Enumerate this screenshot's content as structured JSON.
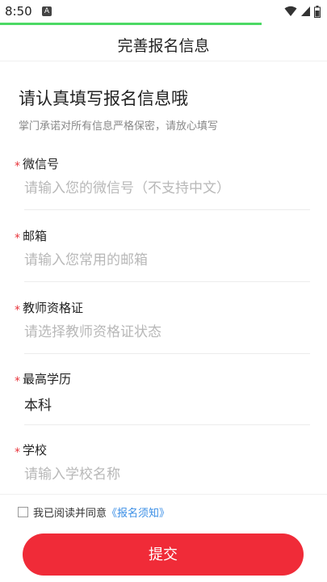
{
  "status_bar": {
    "time": "8:50",
    "notif_icon": "A"
  },
  "header": {
    "title": "完善报名信息"
  },
  "intro": {
    "title": "请认真填写报名信息哦",
    "subtitle": "掌门承诺对所有信息严格保密，请放心填写"
  },
  "form": {
    "required_mark": "*",
    "fields": [
      {
        "label": "微信号",
        "placeholder": "请输入您的微信号（不支持中文）",
        "value": ""
      },
      {
        "label": "邮箱",
        "placeholder": "请输入您常用的邮箱",
        "value": ""
      },
      {
        "label": "教师资格证",
        "placeholder": "请选择教师资格证状态",
        "value": ""
      },
      {
        "label": "最高学历",
        "placeholder": "",
        "value": "本科"
      },
      {
        "label": "学校",
        "placeholder": "请输入学校名称",
        "value": ""
      }
    ]
  },
  "agreement": {
    "checked": false,
    "text": "我已阅读并同意",
    "link": "《报名须知》"
  },
  "submit": {
    "label": "提交"
  },
  "colors": {
    "accent": "#f02b38",
    "link": "#3a8ee6",
    "progress": "#4cd964"
  }
}
